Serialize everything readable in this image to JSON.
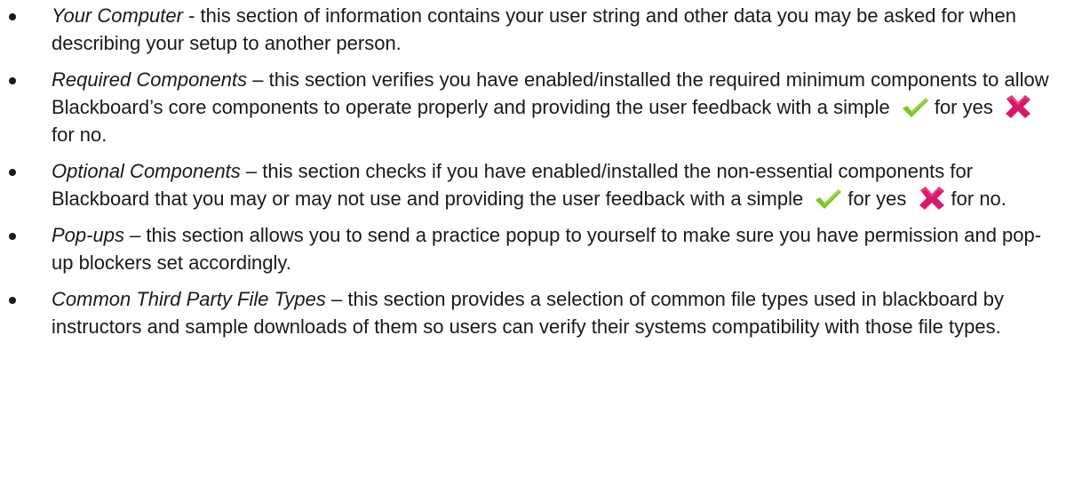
{
  "items": [
    {
      "term": "Your Computer",
      "separator": " - ",
      "text": "this section of information contains your user string and other data you may be asked for when describing your setup to another person."
    },
    {
      "term": "Required Components",
      "separator": " – ",
      "text": "this section verifies you have enabled/installed the required minimum components to allow Blackboard’s core components to operate properly and providing the user feedback with a simple",
      "yes_text": "for yes",
      "no_text": "for no."
    },
    {
      "term": "Optional Components",
      "separator": " – ",
      "text": "this section checks if you have enabled/installed the non-essential components for Blackboard that you may or may not use and providing the user feedback with a simple",
      "yes_text": "for yes",
      "no_text": "for no."
    },
    {
      "term": "Pop-ups",
      "separator": " – ",
      "text": "this section allows you to send a practice popup to yourself to make sure you have permission and pop-up blockers set accordingly."
    },
    {
      "term": "Common Third Party File Types",
      "separator": " – ",
      "text": "this section provides a selection of common file types used in blackboard by instructors and sample downloads of them so users can verify their systems compatibility with those file types."
    }
  ],
  "icons": {
    "check": "check-mark-icon",
    "cross": "x-mark-icon",
    "check_color": "#7cc424",
    "cross_color": "#d8186a"
  }
}
